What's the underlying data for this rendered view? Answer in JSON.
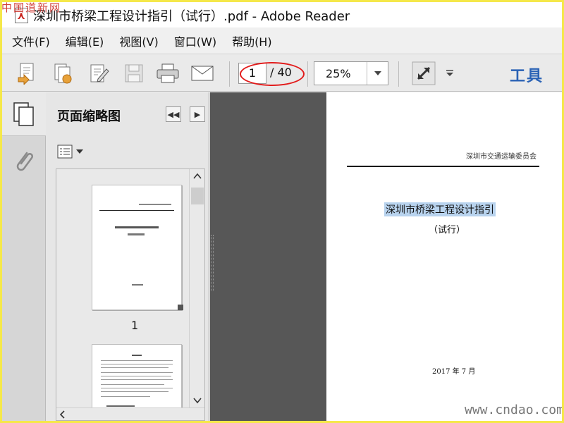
{
  "window": {
    "title": "深圳市桥梁工程设计指引（试行）.pdf - Adobe Reader",
    "icon": "pdf-icon"
  },
  "watermark_top": "中国道新网",
  "menu": [
    {
      "label": "文件(F)"
    },
    {
      "label": "编辑(E)"
    },
    {
      "label": "视图(V)"
    },
    {
      "label": "窗口(W)"
    },
    {
      "label": "帮助(H)"
    }
  ],
  "toolbar": {
    "current_page": "1",
    "page_total": "/ 40",
    "zoom": "25%",
    "tools_label": "工具",
    "icons": [
      "create-pdf-icon",
      "combine-icon",
      "edit-icon",
      "save-icon",
      "print-icon",
      "email-icon",
      "fit-page-icon"
    ]
  },
  "panel": {
    "title": "页面缩略图",
    "thumbnails": [
      {
        "page_label": "1"
      }
    ]
  },
  "document": {
    "header": "深圳市交通运输委员会",
    "title": "深圳市桥梁工程设计指引",
    "subtitle": "（试行）",
    "date": "2017 年 7 月"
  },
  "watermark_bottom": "www.cndao.com",
  "colors": {
    "highlight": "#b8d3ee",
    "annotation": "#e21b1b",
    "tools": "#2a62b5"
  }
}
